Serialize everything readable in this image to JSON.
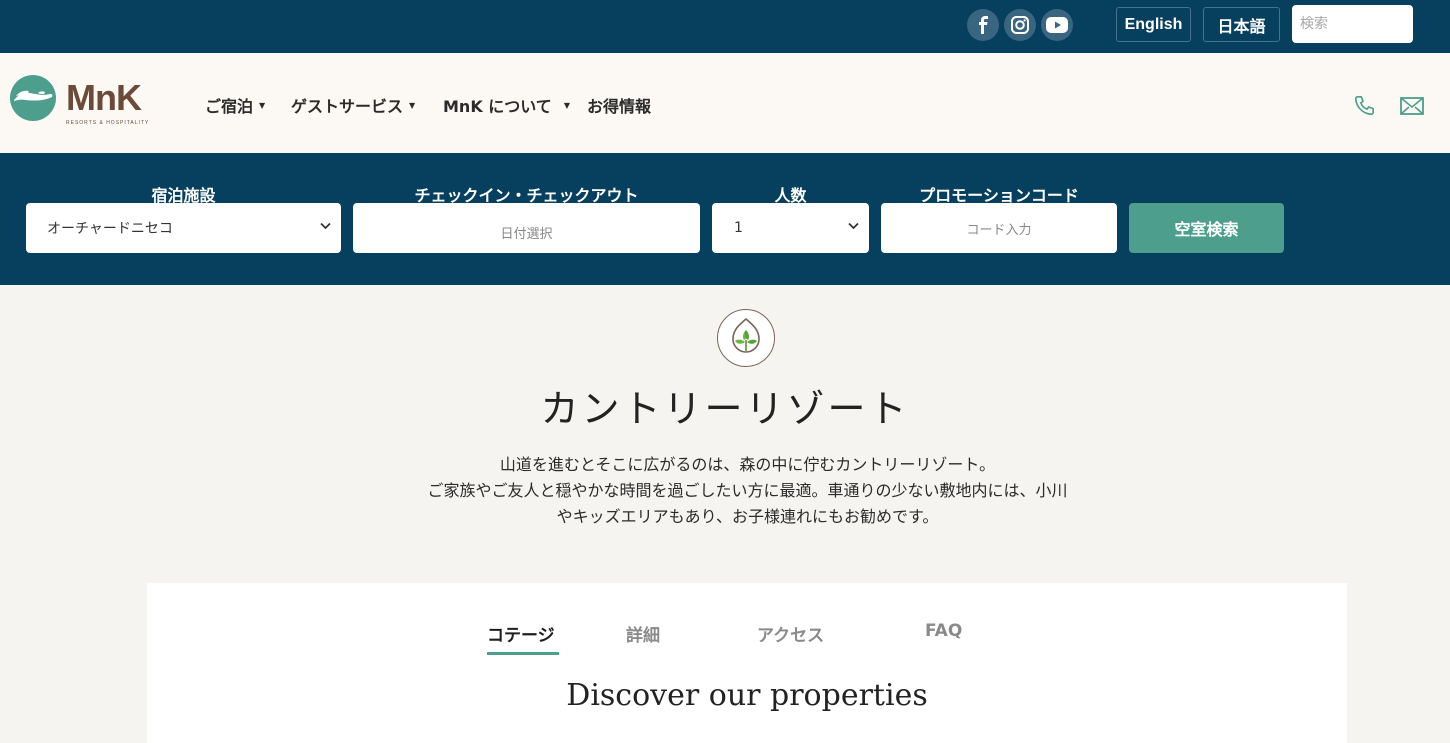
{
  "topbar": {
    "social": [
      "facebook-icon",
      "instagram-icon",
      "youtube-icon"
    ],
    "lang_english": "English",
    "lang_japanese": "日本語",
    "search_placeholder": "検索"
  },
  "header": {
    "logo_text": "MnK",
    "logo_sub": "RESORTS & HOSPITALITY",
    "nav": [
      {
        "label": "ご宿泊"
      },
      {
        "label": "ゲストサービス"
      },
      {
        "label": "MnK について"
      },
      {
        "label": "お得情報"
      }
    ]
  },
  "booking": {
    "property_label": "宿泊施設",
    "property_value": "オーチャードニセコ",
    "dates_label": "チェックイン・チェックアウト",
    "dates_placeholder": "日付選択",
    "guests_label": "人数",
    "guests_value": "1",
    "promo_label": "プロモーションコード",
    "promo_placeholder": "コード入力",
    "search_button": "空室検索"
  },
  "hero": {
    "title": "カントリーリゾート",
    "description_lines": [
      "山道を進むとそこに広がるのは、森の中に佇むカントリーリゾート。",
      "ご家族やご友人と穏やかな時間を過ごしたい方に最適。車通りの少ない敷地内には、小川",
      "やキッズエリアもあり、お子様連れにもお勧めです。"
    ]
  },
  "tabs": [
    {
      "label": "コテージ",
      "active": true
    },
    {
      "label": "詳細",
      "active": false
    },
    {
      "label": "アクセス",
      "active": false
    },
    {
      "label": "FAQ",
      "active": false
    }
  ],
  "section_title": "Discover our properties",
  "colors": {
    "navy": "#073f5e",
    "teal": "#4d9e8d",
    "brown": "#6b4a3a",
    "cream": "#fcf9f4"
  }
}
